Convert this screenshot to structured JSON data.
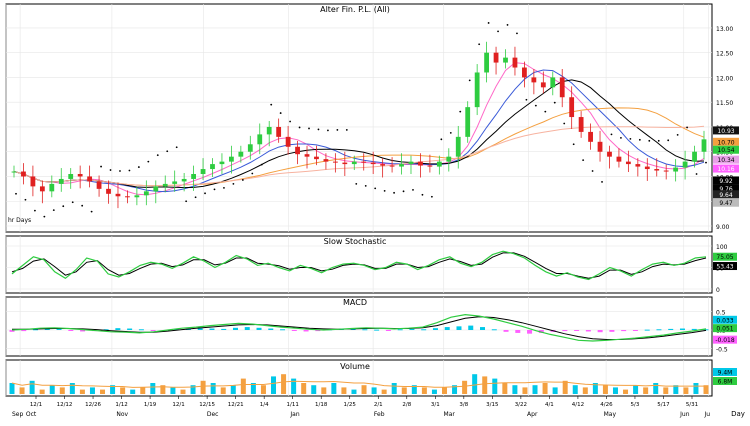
{
  "chart_data": [
    {
      "type": "candlestick",
      "title": "Alter Fin. P.L. (All)",
      "corner_label": "hr Days",
      "ylim": [
        9.0,
        13.2
      ],
      "y_ticks": [
        "13.00",
        "12.50",
        "12.00",
        "11.50",
        "11.00",
        "10.50",
        "10.00",
        "9.50",
        "9.00"
      ],
      "price_tags": [
        "10.93",
        "10.70",
        "10.54",
        "10.34",
        "10.16",
        "9.92",
        "9.76",
        "9.64",
        "9.47"
      ],
      "tag_colors": [
        "#111111",
        "#f4a040",
        "#2ecc40",
        "#e8a0e8",
        "#ff60ff",
        "#000000",
        "#000000",
        "#222222",
        "#bbbbbb"
      ],
      "close": [
        10.1,
        10.0,
        9.8,
        9.7,
        9.85,
        9.95,
        10.05,
        10.0,
        9.9,
        9.75,
        9.65,
        9.6,
        9.58,
        9.62,
        9.7,
        9.8,
        9.85,
        9.9,
        9.95,
        10.05,
        10.15,
        10.25,
        10.3,
        10.4,
        10.5,
        10.65,
        10.85,
        11.0,
        10.8,
        10.6,
        10.45,
        10.4,
        10.35,
        10.3,
        10.28,
        10.25,
        10.3,
        10.28,
        10.25,
        10.22,
        10.2,
        10.25,
        10.3,
        10.22,
        10.2,
        10.3,
        10.4,
        10.8,
        11.4,
        12.1,
        12.5,
        12.3,
        12.4,
        12.2,
        12.0,
        11.9,
        11.8,
        12.0,
        11.6,
        11.2,
        10.9,
        10.7,
        10.5,
        10.4,
        10.3,
        10.25,
        10.2,
        10.15,
        10.12,
        10.1,
        10.18,
        10.3,
        10.5,
        10.75
      ],
      "series_colors": [
        "#ff69c8",
        "#3a5ad8",
        "#f4a040",
        "#000000",
        "#2ecc40"
      ],
      "psar_color": "#000000",
      "up_color": "#2ecc40",
      "down_color": "#e02020"
    },
    {
      "type": "line",
      "title": "Slow Stochastic",
      "ylim": [
        0,
        100
      ],
      "y_ticks": [
        "100",
        "50",
        "0"
      ],
      "tags": [
        "75.05",
        "53.43"
      ],
      "tag_colors": [
        "#2ecc40",
        "#000000"
      ],
      "k": [
        35,
        55,
        75,
        68,
        40,
        25,
        45,
        72,
        65,
        35,
        28,
        40,
        55,
        62,
        58,
        48,
        60,
        75,
        65,
        50,
        62,
        78,
        70,
        55,
        60,
        50,
        42,
        55,
        48,
        38,
        50,
        58,
        60,
        55,
        45,
        50,
        62,
        58,
        45,
        55,
        68,
        75,
        60,
        52,
        62,
        80,
        88,
        82,
        72,
        55,
        40,
        30,
        38,
        28,
        22,
        35,
        50,
        42,
        30,
        45,
        58,
        62,
        55,
        60,
        72,
        75
      ],
      "d": [
        40,
        48,
        65,
        70,
        52,
        32,
        40,
        62,
        66,
        45,
        32,
        36,
        48,
        58,
        60,
        52,
        56,
        68,
        68,
        56,
        60,
        72,
        72,
        60,
        58,
        54,
        46,
        50,
        50,
        42,
        46,
        55,
        58,
        56,
        48,
        48,
        58,
        58,
        50,
        52,
        62,
        70,
        64,
        55,
        58,
        74,
        84,
        84,
        76,
        62,
        48,
        36,
        36,
        30,
        25,
        30,
        44,
        44,
        34,
        40,
        52,
        58,
        56,
        58,
        66,
        72
      ],
      "k_color": "#2ecc40",
      "d_color": "#000000"
    },
    {
      "type": "bar",
      "title": "MACD",
      "ylim": [
        -0.6,
        0.6
      ],
      "y_ticks": [
        "0.5",
        "0.0",
        "-0.5"
      ],
      "tags": [
        "0.033",
        "0.051",
        "-0.018"
      ],
      "tag_colors": [
        "#00c8e8",
        "#2ecc40",
        "#ff60ff"
      ],
      "hist": [
        -0.05,
        -0.03,
        0.02,
        0.04,
        0.03,
        -0.02,
        -0.04,
        -0.03,
        0.02,
        0.05,
        0.04,
        0.02,
        -0.02,
        -0.03,
        0.02,
        0.03,
        0.05,
        0.04,
        0.03,
        0.06,
        0.08,
        0.06,
        0.04,
        0.02,
        -0.02,
        -0.04,
        -0.03,
        0.02,
        0.03,
        0.04,
        0.02,
        0.01,
        -0.01,
        0.02,
        0.03,
        0.02,
        0.05,
        0.08,
        0.1,
        0.12,
        0.08,
        0.02,
        -0.05,
        -0.08,
        -0.1,
        -0.08,
        -0.05,
        -0.03,
        -0.02,
        -0.04,
        -0.06,
        -0.05,
        -0.03,
        -0.02,
        0.01,
        0.02,
        0.03,
        0.04,
        0.03,
        0.02
      ],
      "macd": [
        0.0,
        0.02,
        0.05,
        0.06,
        0.04,
        0.01,
        -0.02,
        -0.05,
        -0.06,
        -0.08,
        -0.05,
        0.0,
        0.05,
        0.08,
        0.12,
        0.15,
        0.18,
        0.16,
        0.12,
        0.08,
        0.05,
        0.02,
        0.0,
        0.02,
        0.04,
        0.06,
        0.05,
        0.03,
        0.05,
        0.08,
        0.2,
        0.35,
        0.42,
        0.38,
        0.3,
        0.2,
        0.1,
        -0.02,
        -0.12,
        -0.2,
        -0.28,
        -0.3,
        -0.28,
        -0.25,
        -0.22,
        -0.18,
        -0.14,
        -0.08,
        -0.03,
        0.03
      ],
      "signal": [
        0.02,
        0.02,
        0.03,
        0.04,
        0.04,
        0.03,
        0.01,
        -0.02,
        -0.04,
        -0.06,
        -0.06,
        -0.03,
        0.01,
        0.05,
        0.08,
        0.11,
        0.14,
        0.15,
        0.14,
        0.11,
        0.08,
        0.05,
        0.03,
        0.02,
        0.03,
        0.04,
        0.05,
        0.04,
        0.04,
        0.06,
        0.12,
        0.22,
        0.32,
        0.36,
        0.34,
        0.28,
        0.2,
        0.1,
        0.0,
        -0.1,
        -0.18,
        -0.24,
        -0.26,
        -0.26,
        -0.24,
        -0.21,
        -0.17,
        -0.12,
        -0.07,
        -0.01
      ],
      "hist_up_color": "#00c8e8",
      "hist_down_color": "#ff60ff",
      "macd_color": "#2ecc40",
      "signal_color": "#000000"
    },
    {
      "type": "bar",
      "title": "Volume",
      "tags": [
        "9.4M",
        "6.8M"
      ],
      "tag_colors": [
        "#00c8e8",
        "#2ecc40"
      ],
      "values": [
        0.5,
        0.3,
        0.6,
        0.2,
        0.4,
        0.3,
        0.5,
        0.2,
        0.3,
        0.2,
        0.4,
        0.3,
        0.2,
        0.3,
        0.5,
        0.4,
        0.3,
        0.2,
        0.4,
        0.6,
        0.5,
        0.3,
        0.4,
        0.7,
        0.5,
        0.4,
        0.8,
        0.9,
        0.7,
        0.5,
        0.4,
        0.3,
        0.5,
        0.3,
        0.2,
        0.4,
        0.3,
        0.2,
        0.5,
        0.3,
        0.4,
        0.3,
        0.2,
        0.3,
        0.4,
        0.6,
        0.9,
        0.8,
        0.7,
        0.5,
        0.4,
        0.3,
        0.4,
        0.5,
        0.3,
        0.6,
        0.4,
        0.3,
        0.5,
        0.4,
        0.3,
        0.2,
        0.4,
        0.3,
        0.5,
        0.3,
        0.4,
        0.3,
        0.5,
        0.4
      ],
      "colors": [
        "#00c8e8",
        "#f4a040"
      ],
      "line_color": "#f4a040"
    }
  ],
  "x_axis": {
    "date_ticks": [
      "12/1",
      "12/12",
      "12/26",
      "1/12",
      "1/19",
      "12/1",
      "12/15",
      "12/21",
      "1/4",
      "1/11",
      "1/18",
      "1/25",
      "2/1",
      "2/8",
      "3/1",
      "3/8",
      "3/15",
      "3/22",
      "4/1",
      "4/12",
      "4/26",
      "5/3",
      "5/17",
      "5/31"
    ],
    "month_labels": [
      "Sep",
      "Oct",
      "Nov",
      "Dec",
      "Jan",
      "Feb",
      "Mar",
      "Apr",
      "May",
      "Jun",
      "Ju"
    ],
    "corner_label": "Day"
  }
}
